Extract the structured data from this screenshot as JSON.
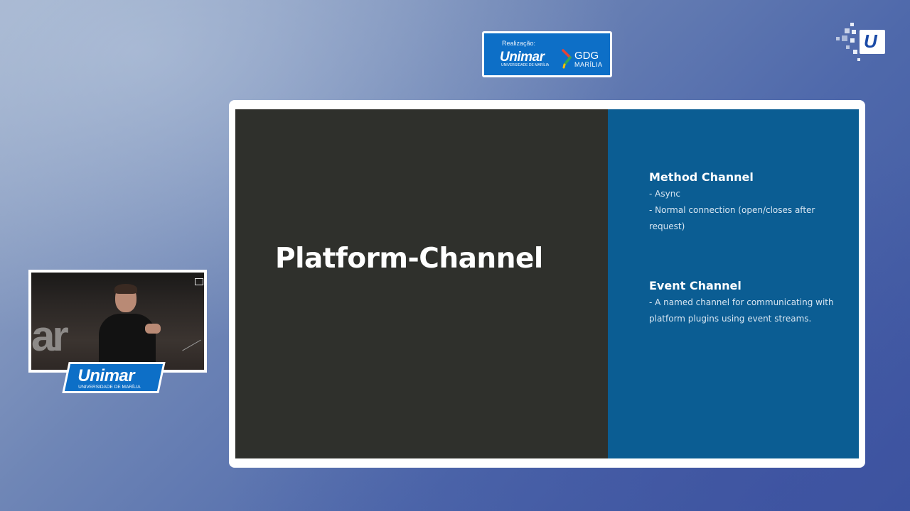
{
  "sponsor": {
    "caption": "Realização:",
    "unimar_logo": "Unimar",
    "unimar_subtitle": "UNIVERSIDADE DE MARÍLIA",
    "gdg_title": "GDG",
    "gdg_subtitle": "MARÍLIA"
  },
  "corner_logo": {
    "letter": "U"
  },
  "slide": {
    "title": "Platform-Channel",
    "sections": [
      {
        "heading": "Method Channel",
        "lines": [
          "- Async",
          "- Normal connection (open/closes after",
          "request)"
        ]
      },
      {
        "heading": "Event Channel",
        "lines": [
          "- A named channel for communicating with",
          "platform plugins using event streams."
        ]
      }
    ]
  },
  "camera": {
    "backdrop_text": "ar"
  },
  "badge": {
    "logo": "Unimar",
    "subtitle": "UNIVERSIDADE DE MARÍLIA"
  },
  "colors": {
    "slide_left_bg": "#2f302c",
    "slide_right_bg": "#0b5d93",
    "brand_blue": "#0d6fc7"
  }
}
